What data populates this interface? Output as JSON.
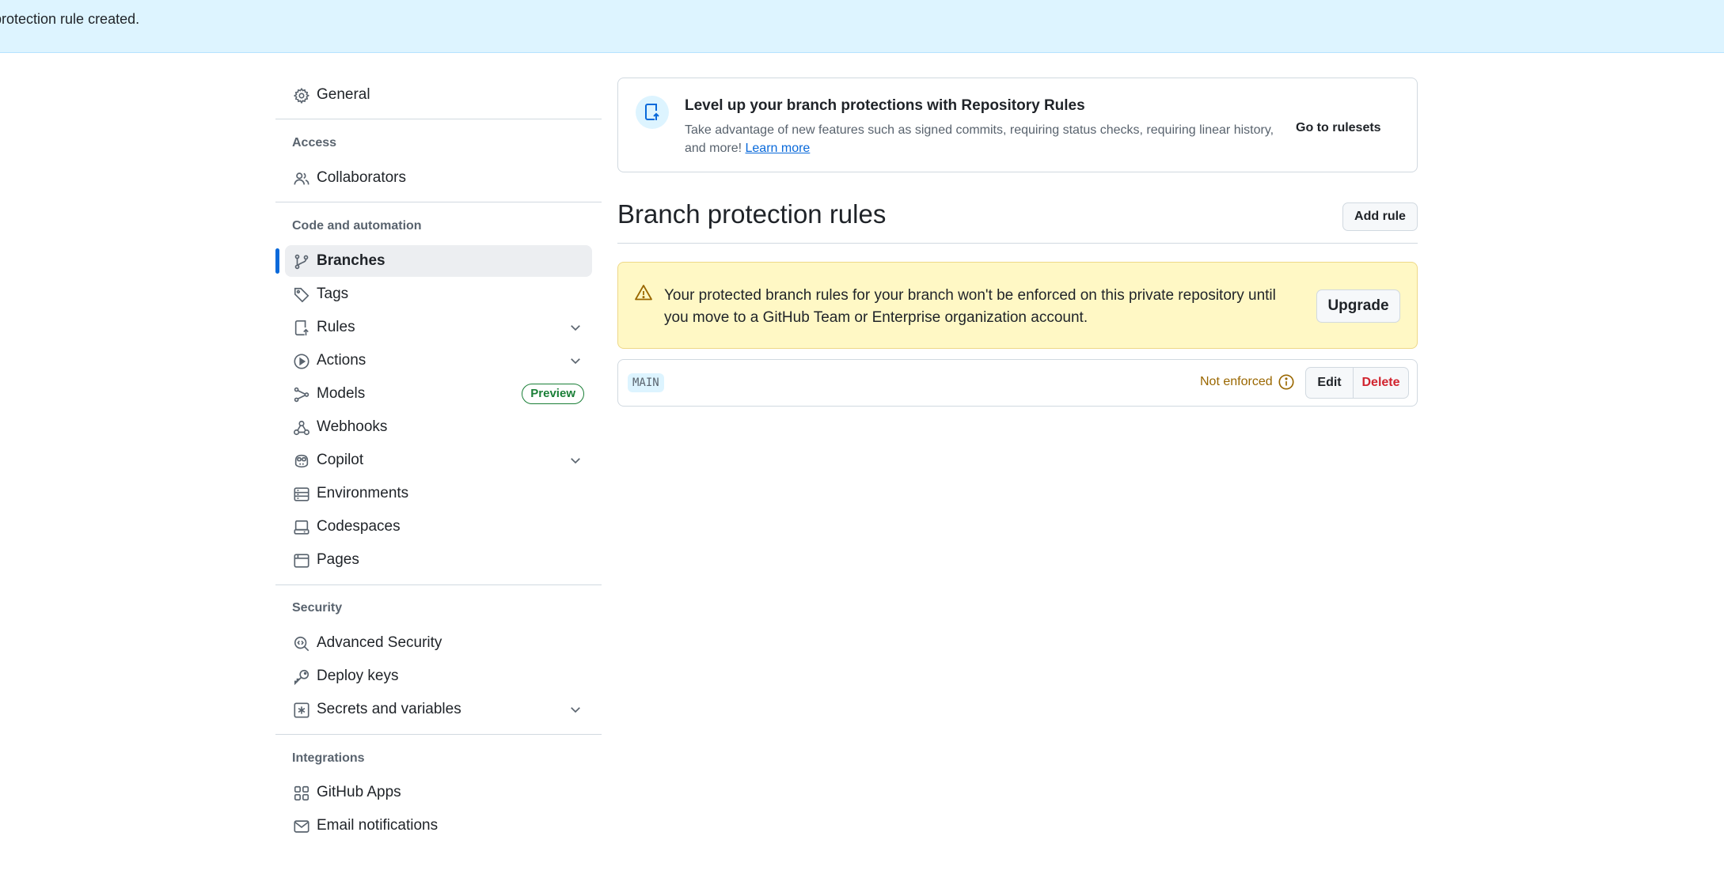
{
  "flash": {
    "message": "protection rule created."
  },
  "sidebar": {
    "general": "General",
    "sections": {
      "access": "Access",
      "code_automation": "Code and automation",
      "security": "Security",
      "integrations": "Integrations"
    },
    "items": {
      "collaborators": "Collaborators",
      "branches": "Branches",
      "tags": "Tags",
      "rules": "Rules",
      "actions": "Actions",
      "models": "Models",
      "models_badge": "Preview",
      "webhooks": "Webhooks",
      "copilot": "Copilot",
      "environments": "Environments",
      "codespaces": "Codespaces",
      "pages": "Pages",
      "advanced_security": "Advanced Security",
      "deploy_keys": "Deploy keys",
      "secrets": "Secrets and variables",
      "github_apps": "GitHub Apps",
      "email_notifications": "Email notifications"
    },
    "selected": "Branches"
  },
  "promo": {
    "title": "Level up your branch protections with Repository Rules",
    "description": "Take advantage of new features such as signed commits, requiring status checks, requiring linear history, and more!",
    "learn_more": "Learn more",
    "cta": "Go to rulesets"
  },
  "main": {
    "title": "Branch protection rules",
    "add_rule": "Add rule"
  },
  "warning": {
    "message": "Your protected branch rules for your branch won't be enforced on this private repository until you move to a GitHub Team or Enterprise organization account.",
    "upgrade": "Upgrade"
  },
  "rules": [
    {
      "branch": "MAIN",
      "status": "Not enforced",
      "edit": "Edit",
      "delete": "Delete"
    }
  ],
  "colors": {
    "accent": "#0969da",
    "flash_bg": "#ddf4ff",
    "warning_bg": "#fff8c5",
    "attention": "#9a6700",
    "danger": "#d1242f",
    "success": "#1a7f37"
  }
}
